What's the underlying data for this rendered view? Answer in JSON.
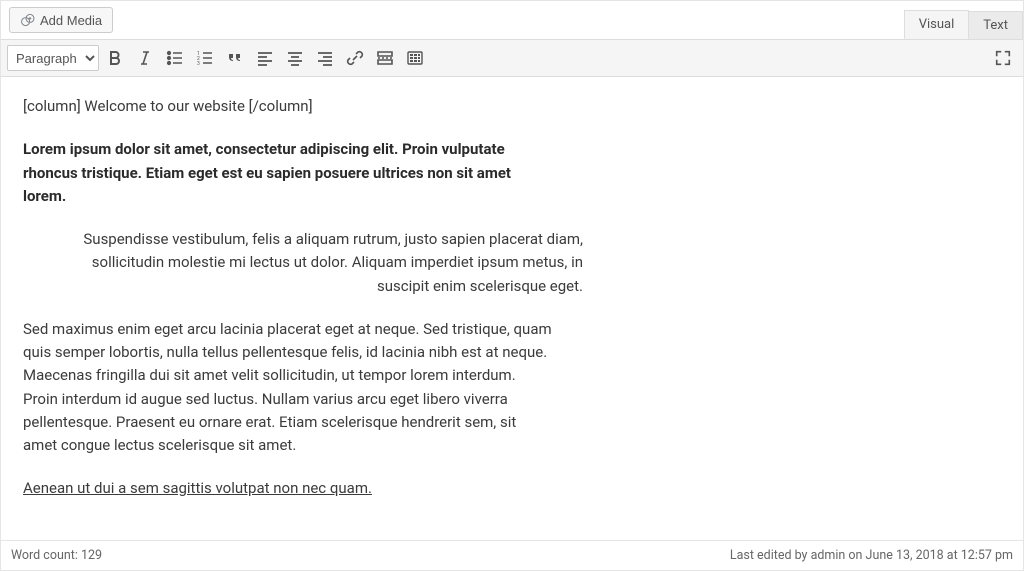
{
  "topbar": {
    "add_media_label": "Add Media"
  },
  "tabs": {
    "visual": "Visual",
    "text": "Text"
  },
  "toolbar": {
    "format_select": "Paragraph"
  },
  "content": {
    "p1": "[column] Welcome to our website [/column]",
    "p2": "Lorem ipsum dolor sit amet, consectetur adipiscing elit. Proin vulputate rhoncus tristique. Etiam eget est eu sapien posuere ultrices non sit amet lorem.",
    "p3": "Suspendisse vestibulum, felis a aliquam rutrum, justo sapien placerat diam, sollicitudin molestie mi lectus ut dolor. Aliquam imperdiet ipsum metus, in suscipit enim scelerisque eget.",
    "p4": "Sed maximus enim eget arcu lacinia placerat eget at neque. Sed tristique, quam quis semper lobortis, nulla tellus pellentesque felis, id lacinia nibh est at neque. Maecenas fringilla dui sit amet velit sollicitudin, ut tempor lorem interdum. Proin interdum id augue sed luctus. Nullam varius arcu eget libero viverra pellentesque. Praesent eu ornare erat. Etiam scelerisque hendrerit sem, sit amet congue lectus scelerisque sit amet.",
    "p5": "Aenean ut dui a sem sagittis volutpat non nec quam."
  },
  "status": {
    "word_count": "Word count: 129",
    "last_edited": "Last edited by admin on June 13, 2018 at 12:57 pm"
  }
}
